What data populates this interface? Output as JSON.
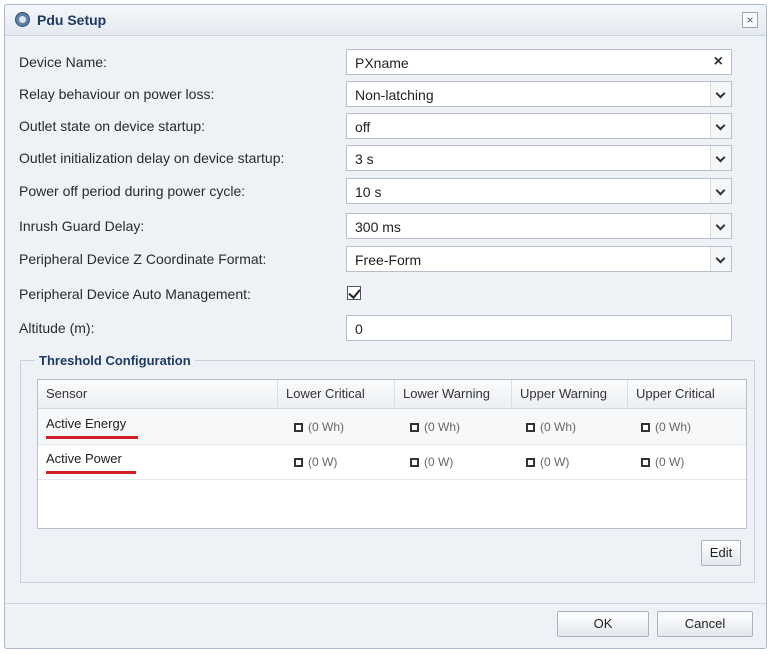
{
  "dialog": {
    "title": "Pdu Setup",
    "close_label": "×"
  },
  "fields": {
    "device_name": {
      "label": "Device Name:",
      "value": "PXname",
      "clear_label": "×"
    },
    "relay_behaviour": {
      "label": "Relay behaviour on power loss:",
      "value": "Non-latching"
    },
    "outlet_state": {
      "label": "Outlet state on device startup:",
      "value": "off"
    },
    "outlet_init_delay": {
      "label": "Outlet initialization delay on device startup:",
      "value": "3 s"
    },
    "power_off_period": {
      "label": "Power off period during power cycle:",
      "value": "10 s"
    },
    "inrush_guard": {
      "label": "Inrush Guard Delay:",
      "value": "300 ms"
    },
    "z_coordinate_format": {
      "label": "Peripheral Device Z Coordinate Format:",
      "value": "Free-Form"
    },
    "auto_management": {
      "label": "Peripheral Device Auto Management:",
      "checked": true
    },
    "altitude": {
      "label": "Altitude (m):",
      "value": "0"
    }
  },
  "threshold": {
    "legend": "Threshold Configuration",
    "columns": [
      "Sensor",
      "Lower Critical",
      "Lower Warning",
      "Upper Warning",
      "Upper Critical"
    ],
    "rows": [
      {
        "sensor": "Active Energy",
        "unit": "(0 Wh)",
        "highlight_color": "#d21f26"
      },
      {
        "sensor": "Active Power",
        "unit": "(0 W)",
        "highlight_color": "#d21f26"
      }
    ],
    "edit_label": "Edit"
  },
  "footer": {
    "ok_label": "OK",
    "cancel_label": "Cancel"
  }
}
